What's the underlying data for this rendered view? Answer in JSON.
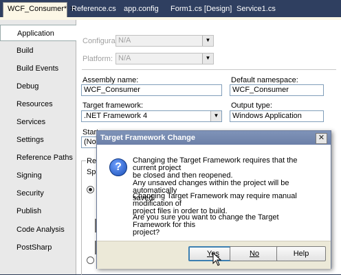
{
  "tabs": [
    {
      "label": "WCF_Consumer*",
      "close": "✕",
      "active": true
    },
    {
      "label": "Reference.cs"
    },
    {
      "label": "app.config"
    },
    {
      "label": "Form1.cs [Design]"
    },
    {
      "label": "Service1.cs"
    }
  ],
  "sidebar": {
    "items": [
      {
        "label": "Application",
        "active": true
      },
      {
        "label": "Build"
      },
      {
        "label": "Build Events"
      },
      {
        "label": "Debug"
      },
      {
        "label": "Resources"
      },
      {
        "label": "Services"
      },
      {
        "label": "Settings"
      },
      {
        "label": "Reference Paths"
      },
      {
        "label": "Signing"
      },
      {
        "label": "Security"
      },
      {
        "label": "Publish"
      },
      {
        "label": "Code Analysis"
      },
      {
        "label": "PostSharp"
      }
    ]
  },
  "form": {
    "configuration_label": "Configuration:",
    "configuration_value": "N/A",
    "platform_label": "Platform:",
    "platform_value": "N/A",
    "assembly_name_label": "Assembly name:",
    "assembly_name_value": "WCF_Consumer",
    "default_namespace_label": "Default namespace:",
    "default_namespace_value": "WCF_Consumer",
    "target_framework_label": "Target framework:",
    "target_framework_value": ".NET Framework 4",
    "output_type_label": "Output type:",
    "output_type_value": "Windows Application",
    "startup_label_partial": "Start",
    "startup_value_partial": "(Not",
    "resources_partial": "Res",
    "spec_partial": "Spe"
  },
  "dialog": {
    "title": "Target Framework Change",
    "close": "✕",
    "icon": "?",
    "para1": [
      "Changing the Target Framework requires that the current project",
      "be closed and then reopened.",
      "Any unsaved changes within the project will be automatically",
      "saved."
    ],
    "para2": [
      "Changing Target Framework may require manual modification of",
      "project files in order to build."
    ],
    "para3": [
      "Are you sure you want to change the Target Framework for this",
      "project?"
    ],
    "buttons": {
      "yes": "Yes",
      "no": "No",
      "help": "Help"
    }
  }
}
